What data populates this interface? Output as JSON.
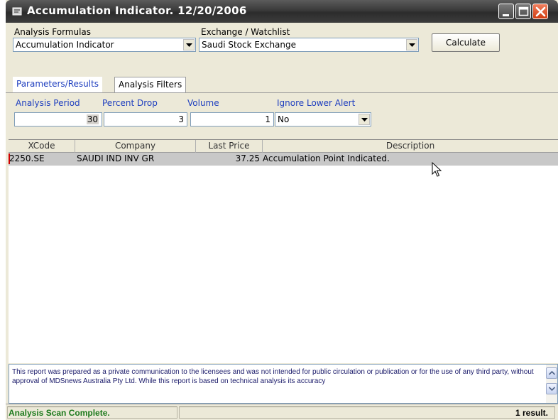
{
  "window": {
    "title": "Accumulation Indicator. 12/20/2006"
  },
  "formulas": {
    "label": "Analysis Formulas",
    "selected": "Accumulation Indicator"
  },
  "exchange": {
    "label": "Exchange / Watchlist",
    "selected": "Saudi Stock Exchange"
  },
  "calculate_label": "Calculate",
  "tabs": [
    {
      "label": "Parameters/Results",
      "active": true
    },
    {
      "label": "Analysis Filters",
      "active": false
    }
  ],
  "params": {
    "analysis_period": {
      "label": "Analysis Period",
      "value": "30"
    },
    "percent_drop": {
      "label": "Percent Drop",
      "value": "3"
    },
    "volume": {
      "label": "Volume",
      "value": "1"
    },
    "ignore_lower_alert": {
      "label": "Ignore Lower Alert",
      "value": "No"
    }
  },
  "grid": {
    "columns": [
      "XCode",
      "Company",
      "Last Price",
      "Description"
    ],
    "rows": [
      {
        "xcode": "2250.SE",
        "company": "SAUDI IND INV GR",
        "last_price": "37.25",
        "description": "Accumulation Point Indicated."
      }
    ]
  },
  "disclaimer": "This report was prepared as a private communication to the licensees and was not intended for public circulation or publication or for the use of any third party, without approval of MDSnews Australia Pty Ltd. While this report is based on technical analysis its accuracy",
  "status": {
    "message": "Analysis Scan Complete.",
    "result": "1 result."
  },
  "icons": {
    "app": "app-icon",
    "minimize": "minimize-icon",
    "maximize": "maximize-icon",
    "close": "close-icon",
    "dropdown": "chevron-down-icon",
    "scroll_up": "chevron-up-icon",
    "scroll_down": "chevron-down-icon",
    "cursor": "mouse-pointer-icon"
  },
  "colors": {
    "title_bar": "#3a3a3a",
    "close_button": "#d23c10",
    "tab_active_text": "#1f3fbf",
    "status_text": "#1c7a1c",
    "selected_row": "#c8c8c8"
  }
}
